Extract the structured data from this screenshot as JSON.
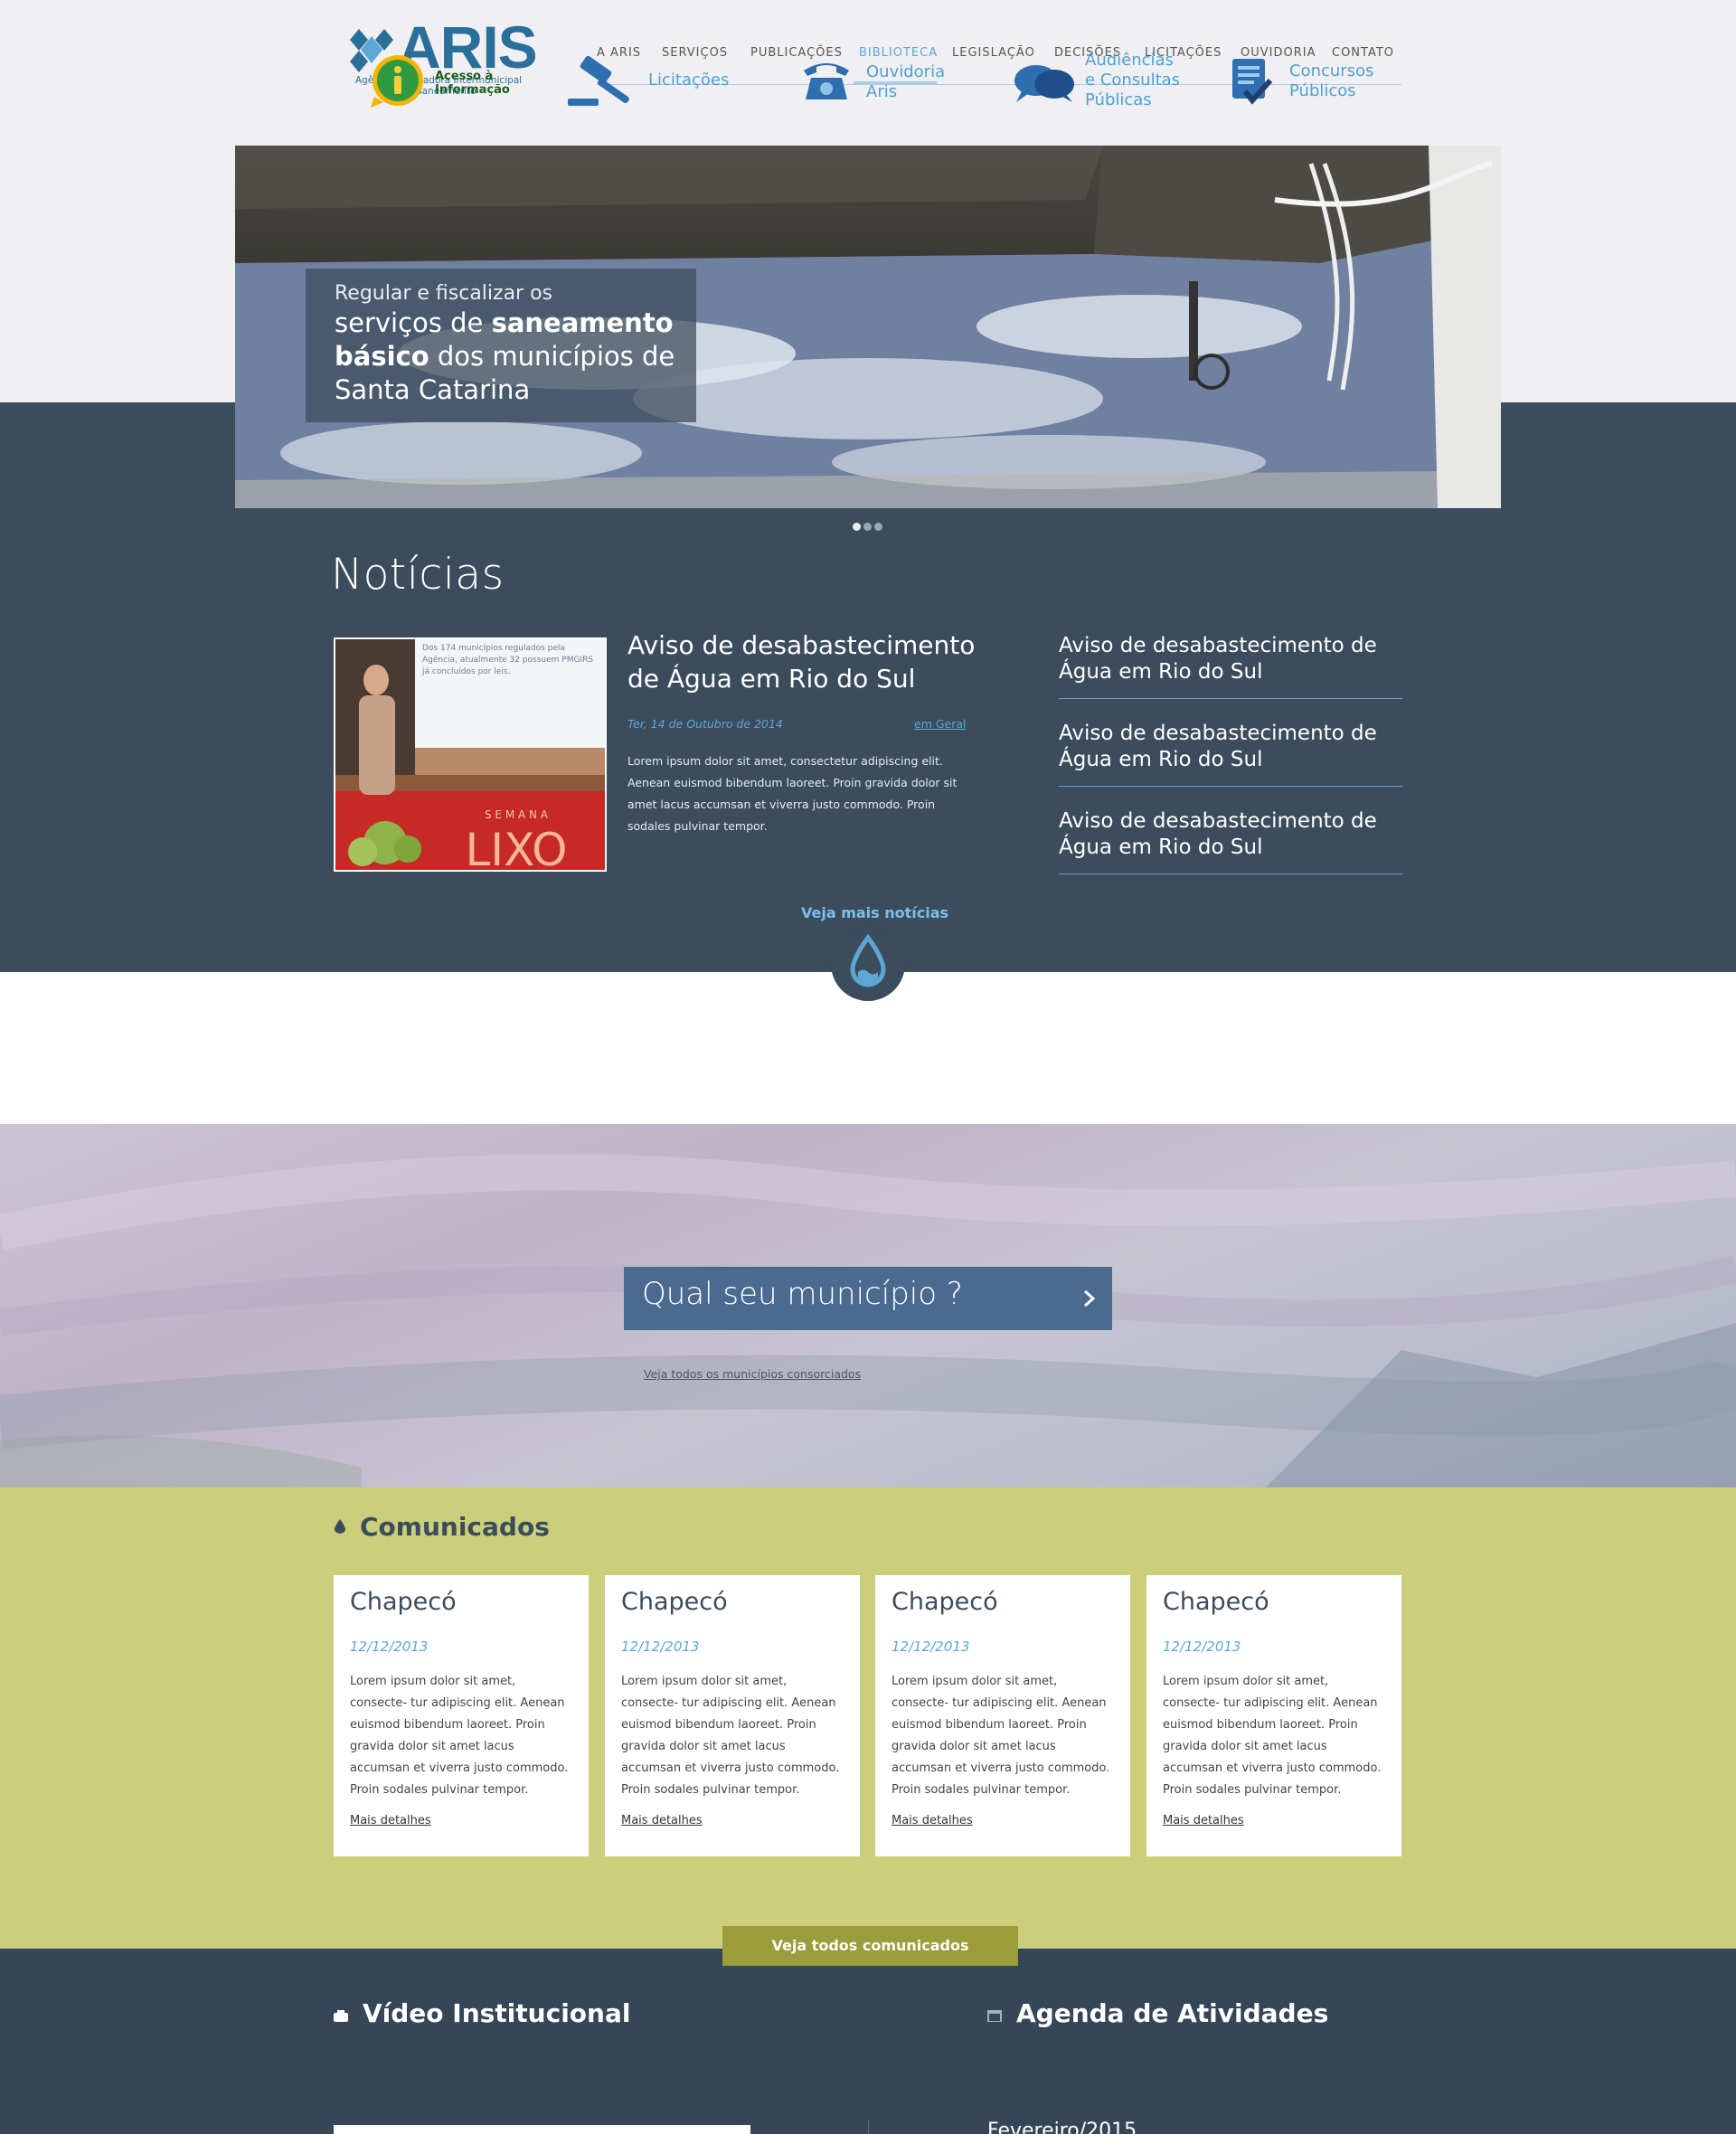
{
  "header": {
    "logo_text": "ARIS",
    "logo_sub_line1": "Agência Reguladora Intermunicipal",
    "logo_sub_line2": "de Saneamento",
    "nav": [
      "A ARIS",
      "SERVIÇOS",
      "PUBLICAÇÕES",
      "BIBLIOTECA",
      "LEGISLAÇÃO",
      "DECISÕES",
      "LICITAÇÕES",
      "OUVIDORIA",
      "CONTATO"
    ],
    "active_nav": "BIBLIOTECA"
  },
  "hero": {
    "caption_top": "Regular e fiscalizar os",
    "caption_line2_pre": "serviços de ",
    "caption_line2_bold": "saneamento",
    "caption_line3_bold": "básico",
    "caption_line3_post": " dos municípios de",
    "caption_line4": "Santa Catarina",
    "slides_count": 3,
    "active_slide": 1
  },
  "news": {
    "section_title": "Notícias",
    "featured": {
      "headline": "Aviso de desabastecimento de Água em Rio do Sul",
      "date": "Ter, 14 de Outubro de 2014",
      "category": "em Geral",
      "body": "Lorem ipsum dolor sit amet, consectetur adipiscing elit. Aenean euismod bibendum laoreet. Proin gravida dolor sit amet lacus accumsan et viverra justo commodo. Proin sodales pulvinar tempor.",
      "photo_text_top": "Dos 174 municípios regulados pela Agência, atualmente 32 possuem PMGIRS já concluídos por leis.",
      "photo_banner_small": "S E M A N A",
      "photo_banner_big": "LIXO"
    },
    "side_items": [
      "Aviso de desabastecimento de Água em Rio do Sul",
      "Aviso de desabastecimento de Água em Rio do Sul",
      "Aviso de desabastecimento de Água em Rio do Sul"
    ],
    "more_link": "Veja mais notícias"
  },
  "quick_links": [
    {
      "label": "Acesso à Informação",
      "icon": "info-icon"
    },
    {
      "label": "Licitações",
      "icon": "gavel-icon"
    },
    {
      "label": "Ouvidoria Aris",
      "icon": "phone-icon"
    },
    {
      "label": "Audiências e Consultas Públicas",
      "icon": "chat-bubbles-icon"
    },
    {
      "label": "Concursos Públicos",
      "icon": "document-check-icon"
    }
  ],
  "municipio": {
    "question": "Qual seu município ?",
    "link": "Veja todos os municípios consorciados"
  },
  "comunicados": {
    "title": "Comunicados",
    "cards": [
      {
        "title": "Chapecó",
        "date": "12/12/2013",
        "body": "Lorem ipsum dolor sit amet, consecte- tur adipiscing elit. Aenean euismod bibendum laoreet. Proin gravida dolor sit amet lacus accumsan et viverra justo commodo. Proin sodales pulvinar tempor.",
        "more": "Mais detalhes"
      },
      {
        "title": "Chapecó",
        "date": "12/12/2013",
        "body": "Lorem ipsum dolor sit amet, consecte- tur adipiscing elit. Aenean euismod bibendum laoreet. Proin gravida dolor sit amet lacus accumsan et viverra justo commodo. Proin sodales pulvinar tempor.",
        "more": "Mais detalhes"
      },
      {
        "title": "Chapecó",
        "date": "12/12/2013",
        "body": "Lorem ipsum dolor sit amet, consecte- tur adipiscing elit. Aenean euismod bibendum laoreet. Proin gravida dolor sit amet lacus accumsan et viverra justo commodo. Proin sodales pulvinar tempor.",
        "more": "Mais detalhes"
      },
      {
        "title": "Chapecó",
        "date": "12/12/2013",
        "body": "Lorem ipsum dolor sit amet, consecte- tur adipiscing elit. Aenean euismod bibendum laoreet. Proin gravida dolor sit amet lacus accumsan et viverra justo commodo. Proin sodales pulvinar tempor.",
        "more": "Mais detalhes"
      }
    ],
    "more_button": "Veja todos comunicados"
  },
  "bottom": {
    "video_title": "Vídeo Institucional",
    "agenda_title": "Agenda de Atividades",
    "agenda_month": "Fevereiro/2015"
  },
  "colors": {
    "brand_blue": "#2a6f9a",
    "accent_blue": "#5ba8d6",
    "dark_slate": "#3b4c5c",
    "olive": "#cbcf7b",
    "olive_button": "#9b9c3b"
  }
}
